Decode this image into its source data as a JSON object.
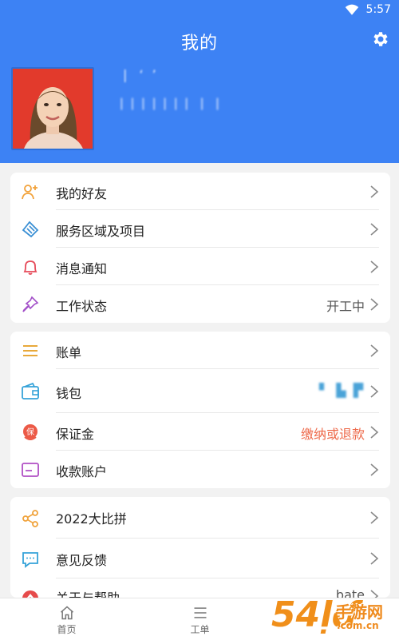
{
  "status_bar": {
    "time": "5:57"
  },
  "header": {
    "title": "我的"
  },
  "profile": {
    "name": "❘ ‘ ’",
    "phone": "❘❘❘❘❘❘❘ ❘ ❘"
  },
  "group1": [
    {
      "label": "我的好友",
      "value": ""
    },
    {
      "label": "服务区域及项目",
      "value": ""
    },
    {
      "label": "消息通知",
      "value": ""
    },
    {
      "label": "工作状态",
      "value": "开工中"
    }
  ],
  "group2": [
    {
      "label": "账单",
      "value": ""
    },
    {
      "label": "钱包",
      "value": "▘ ▙ ▛"
    },
    {
      "label": "保证金",
      "value": "缴纳或退款"
    },
    {
      "label": "收款账户",
      "value": ""
    }
  ],
  "group3": [
    {
      "label": "2022大比拼",
      "value": ""
    },
    {
      "label": "意见反馈",
      "value": ""
    },
    {
      "label": "关于与帮助",
      "value": "bate"
    }
  ],
  "tabs": [
    {
      "label": "首页"
    },
    {
      "label": "工单"
    },
    {
      "label": ""
    }
  ],
  "watermark": {
    "big": "54ḷɗ",
    "small": "手游网",
    "site": ".com.cn"
  },
  "colors": {
    "header_bg": "#3d82f4",
    "accent_orange": "#ee6a4b"
  }
}
